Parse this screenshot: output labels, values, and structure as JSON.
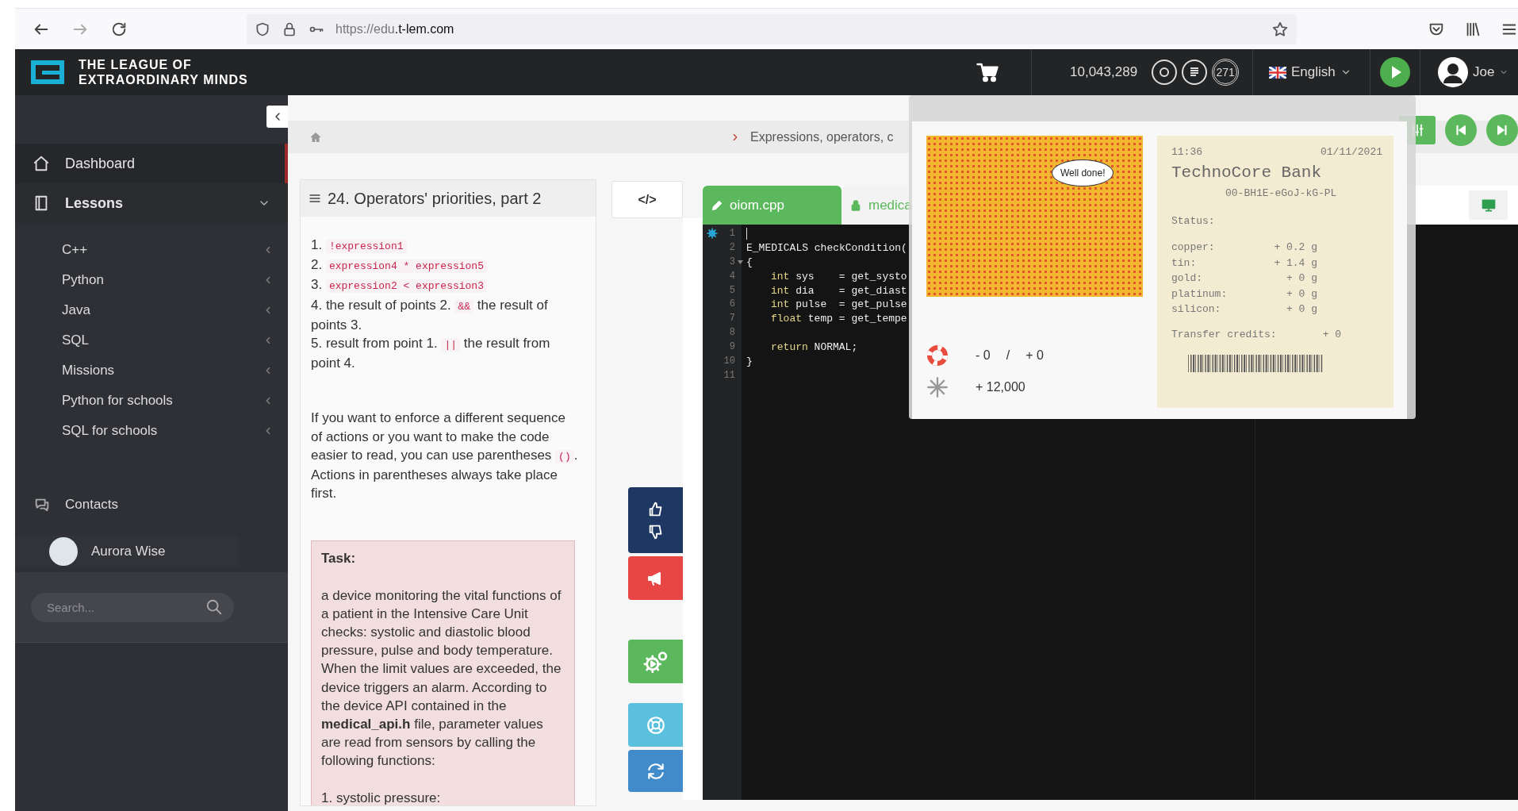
{
  "browser": {
    "url_prefix": "https://edu",
    "url_domain": ".t-lem.com"
  },
  "header": {
    "logo_lines": [
      "THE LEAGUE OF",
      "EXTRAORDINARY MINDS"
    ],
    "balance": "10,043,289",
    "badge": "271",
    "language": "English",
    "user": "Joe"
  },
  "sidebar": {
    "items": [
      {
        "label": "Dashboard",
        "selected": true,
        "expanded": false
      },
      {
        "label": "Lessons",
        "selected": false,
        "expanded": true,
        "children": [
          {
            "label": "C++"
          },
          {
            "label": "Python"
          },
          {
            "label": "Java"
          },
          {
            "label": "SQL"
          },
          {
            "label": "Missions"
          },
          {
            "label": "Python for schools"
          },
          {
            "label": "SQL for schools"
          }
        ]
      }
    ],
    "contacts": {
      "label": "Contacts",
      "people": [
        {
          "name": "Aurora Wise"
        }
      ]
    },
    "search": {
      "placeholder": "Search..."
    }
  },
  "breadcrumb": {
    "text": "Expressions, operators, c"
  },
  "lesson": {
    "title": "24. Operators' priorities, part 2",
    "list": [
      [
        {
          "kind": "text",
          "text": "1. "
        },
        {
          "kind": "code",
          "text": "!expression1"
        }
      ],
      [
        {
          "kind": "text",
          "text": "2. "
        },
        {
          "kind": "code",
          "text": "expression4 * expression5"
        }
      ],
      [
        {
          "kind": "text",
          "text": "3. "
        },
        {
          "kind": "code",
          "text": "expression2 < expression3"
        }
      ],
      [
        {
          "kind": "text",
          "text": "4. the result of points 2. "
        },
        {
          "kind": "code",
          "text": "&&"
        },
        {
          "kind": "text",
          "text": " the result of points 3."
        }
      ],
      [
        {
          "kind": "text",
          "text": "5. result from point 1. "
        },
        {
          "kind": "code",
          "text": "||"
        },
        {
          "kind": "text",
          "text": " the result from point 4."
        }
      ]
    ],
    "paragraph": [
      {
        "kind": "text",
        "text": "If you want to enforce a different sequence of actions or you want to make the code easier to read, you can use parentheses "
      },
      {
        "kind": "code",
        "text": "()"
      },
      {
        "kind": "text",
        "text": ". Actions in parentheses always take place first."
      }
    ],
    "task": {
      "title": "Task:",
      "text": "a device monitoring the vital functions of a patient in the Intensive Care Unit checks: systolic and diastolic blood pressure, pulse and body temperature. When the limit values are exceeded, the device triggers an alarm. According to the device API contained in the **medical_api.h** file, parameter values are read from sensors by calling the following functions:",
      "step": "1. systolic pressure:"
    }
  },
  "tools": {
    "code_tab": "</>"
  },
  "editor": {
    "tabs": [
      {
        "label": "oiom.cpp",
        "selected": true
      },
      {
        "label": "medica",
        "selected": false
      }
    ],
    "lines": [
      {
        "number": "1",
        "cursor": true
      },
      {
        "number": "2",
        "tokens": [
          {
            "kind": "plain",
            "text": "E_MEDICALS checkCondition("
          }
        ]
      },
      {
        "number": "3",
        "foldable": true,
        "tokens": [
          {
            "kind": "plain",
            "text": "{"
          }
        ]
      },
      {
        "number": "4",
        "indented": true,
        "tokens": [
          {
            "kind": "keyword",
            "text": "int"
          },
          {
            "kind": "plain",
            "text": " sys    = get_systo"
          }
        ]
      },
      {
        "number": "5",
        "indented": true,
        "tokens": [
          {
            "kind": "keyword",
            "text": "int"
          },
          {
            "kind": "plain",
            "text": " dia    = get_diast"
          }
        ]
      },
      {
        "number": "6",
        "indented": true,
        "tokens": [
          {
            "kind": "keyword",
            "text": "int"
          },
          {
            "kind": "plain",
            "text": " pulse  = get_pulse"
          }
        ]
      },
      {
        "number": "7",
        "indented": true,
        "tokens": [
          {
            "kind": "keyword",
            "text": "float"
          },
          {
            "kind": "plain",
            "text": " temp = get_tempe"
          }
        ]
      },
      {
        "number": "8"
      },
      {
        "number": "9",
        "indented": true,
        "tokens": [
          {
            "kind": "keyword",
            "text": "return"
          },
          {
            "kind": "plain",
            "text": " NORMAL;"
          }
        ]
      },
      {
        "number": "10",
        "tokens": [
          {
            "kind": "plain",
            "text": "}"
          }
        ]
      },
      {
        "number": "11"
      }
    ]
  },
  "popup": {
    "speech": "Well done!",
    "lives": {
      "lost": "- 0",
      "separator": "/",
      "gained": "+ 0"
    },
    "reward": "+ 12,000",
    "receipt": {
      "time": "11:36",
      "date": "01/11/2021",
      "bank": "TechnoCore Bank",
      "account": "00-BH1E-eGoJ-kG-PL",
      "status_label": "Status:",
      "resources": [
        {
          "name": "copper:",
          "amount": "+ 0.2 g"
        },
        {
          "name": "tin:",
          "amount": "+ 1.4 g"
        },
        {
          "name": "gold:",
          "amount": "+ 0 g"
        },
        {
          "name": "platinum:",
          "amount": "+ 0 g"
        },
        {
          "name": "silicon:",
          "amount": "+ 0 g"
        }
      ],
      "credits": {
        "label": "Transfer credits:",
        "amount": "+ 0"
      }
    }
  }
}
